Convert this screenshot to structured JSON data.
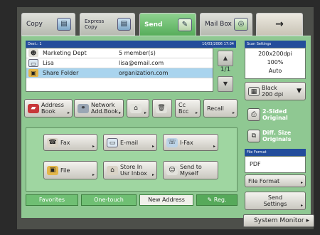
{
  "tabs": [
    {
      "label": "Copy",
      "icon": "copy-icon",
      "glyph": "▤"
    },
    {
      "label": "Express Copy",
      "icon": "express-copy-icon",
      "glyph": "▤"
    },
    {
      "label": "Send",
      "icon": "send-icon",
      "glyph": "✎"
    },
    {
      "label": "Mail Box",
      "icon": "mailbox-icon",
      "glyph": "◎"
    },
    {
      "label": "→",
      "icon": "arrow-right-icon"
    }
  ],
  "destination": {
    "header_label": "Dest.:   1",
    "datetime": "10/03/2006 17:04",
    "rows": [
      {
        "name": "Marketing Dept",
        "detail": "5 member(s)",
        "icon": "group-icon",
        "glyph": "☻",
        "selected": false
      },
      {
        "name": "Lisa",
        "detail": "lisa@email.com",
        "icon": "email-icon",
        "glyph": "▭",
        "selected": false
      },
      {
        "name": "Share Folder",
        "detail": "organization.com",
        "icon": "folder-icon",
        "glyph": "▣",
        "selected": true
      }
    ],
    "page": "1/1"
  },
  "buttons": {
    "address_book": "Address\nBook",
    "network_address_book": "Network\nAdd.Book",
    "cc_bcc": "Cc\nBcc",
    "recall": "Recall"
  },
  "send_types": {
    "fax": "Fax",
    "email": "E-mail",
    "ifax": "I-Fax",
    "file": "File",
    "store_in_usr_inbox": "Store In\nUsr Inbox",
    "send_to_myself": "Send to\nMyself"
  },
  "bottom_tabs": {
    "favorites": "Favorites",
    "one_touch": "One-touch",
    "new_address": "New Address",
    "reg": "Reg."
  },
  "scan_settings": {
    "header": "Scan Settings",
    "resolution": "200x200dpi",
    "zoom": "100%",
    "mode": "Auto",
    "color_label": "Black",
    "color_dpi": "200 dpi",
    "two_sided": "2-Sided\nOriginal",
    "diff_size": "Diff. Size\nOriginals"
  },
  "file_format": {
    "header": "File Format",
    "value": "PDF",
    "button": "File Format"
  },
  "send_settings": "Send\nSettings",
  "system_monitor": "System Monitor",
  "colors": {
    "active_tab": "#55ac59",
    "panel": "#8fc892",
    "header_blue": "#234d9b",
    "selected_row": "#a9d4ee"
  }
}
